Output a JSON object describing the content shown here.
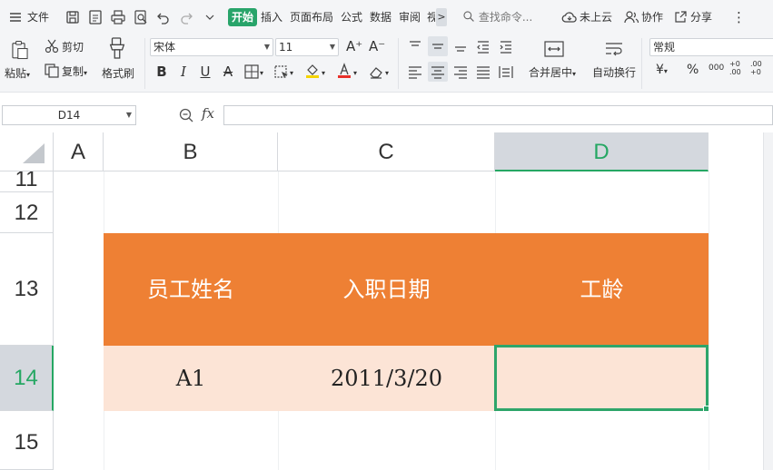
{
  "menubar": {
    "file_label": "文件",
    "tabs": [
      "开始",
      "插入",
      "页面布局",
      "公式",
      "数据",
      "审阅",
      "视"
    ],
    "more_symbol": ">",
    "search_placeholder": "查找命令...",
    "cloud_label": "未上云",
    "collab_label": "协作",
    "share_label": "分享",
    "overflow_symbol": "⋮"
  },
  "ribbon": {
    "paste_label": "粘贴",
    "cut_label": "剪切",
    "copy_label": "复制",
    "format_painter_label": "格式刷",
    "font_name": "宋体",
    "font_size": "11",
    "grow_symbol": "A⁺",
    "shrink_symbol": "A⁻",
    "bold": "B",
    "italic": "I",
    "underline": "U",
    "strike": "A",
    "merge_label": "合并居中",
    "wrap_label": "自动换行",
    "number_format": "常规",
    "currency_symbol": "¥",
    "percent_symbol": "%",
    "thousands_symbol": "000",
    "inc_decimal": "+0 .00",
    "dec_decimal": ".00 +0"
  },
  "formula_bar": {
    "cell_ref": "D14",
    "fx": "fx",
    "formula": ""
  },
  "grid": {
    "columns": [
      "A",
      "B",
      "C",
      "D"
    ],
    "selected_column": "D",
    "rows": [
      "11",
      "12",
      "13",
      "14",
      "15"
    ],
    "selected_row": "14",
    "table": {
      "headers": [
        "员工姓名",
        "入职日期",
        "工龄"
      ],
      "row": [
        "A1",
        "2011/3/20",
        ""
      ]
    }
  },
  "colors": {
    "accent": "#28a46a",
    "header_fill": "#ee8034",
    "data_fill": "#fce4d6",
    "selection": "#2ea56a"
  }
}
